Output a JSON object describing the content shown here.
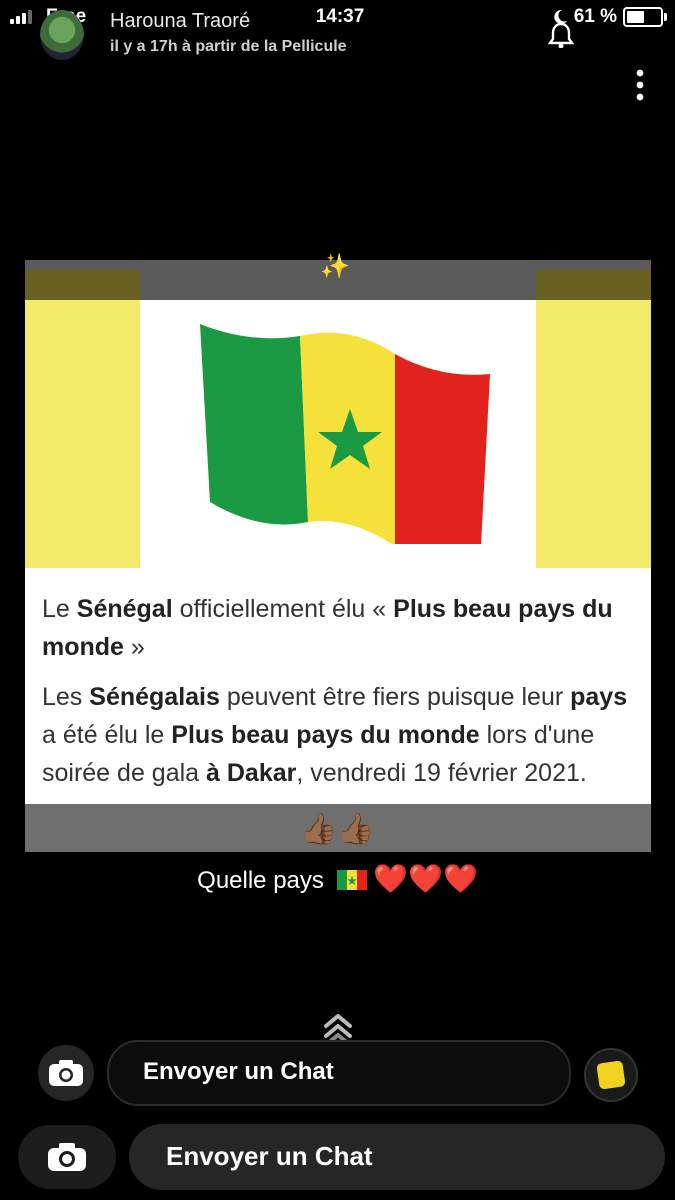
{
  "status_bar": {
    "carrier": "Free",
    "time": "14:37",
    "battery": "61 %",
    "battery_level": 0.61
  },
  "header": {
    "username": "Harouna Traoré",
    "subtitle": "il y a 17h à partir de la Pellicule"
  },
  "snap": {
    "article": {
      "headline_parts": [
        "Le ",
        "Sénégal",
        " officiellement élu « ",
        "Plus beau pays du monde",
        " »"
      ],
      "body_parts": [
        "Les ",
        "Sénégalais",
        " peuvent être fiers puisque leur ",
        "pays",
        " a été élu le ",
        "Plus beau pays du monde",
        " lors d'une soirée de gala ",
        "à Dakar",
        ", vendredi 19 février 2021."
      ]
    },
    "sparkle": "✨",
    "thumbs": "👍🏾👍🏾",
    "caption_text": "Quelle pays",
    "caption_hearts": "❤️❤️❤️"
  },
  "chat": {
    "label_upper": "Envoyer un Chat",
    "label_lower": "Envoyer un Chat"
  },
  "icons": [
    "signal-icon",
    "moon-icon",
    "battery-icon",
    "bell-icon",
    "more-vertical-icon",
    "chevron-up-icon",
    "camera-icon",
    "sticker-icon"
  ]
}
